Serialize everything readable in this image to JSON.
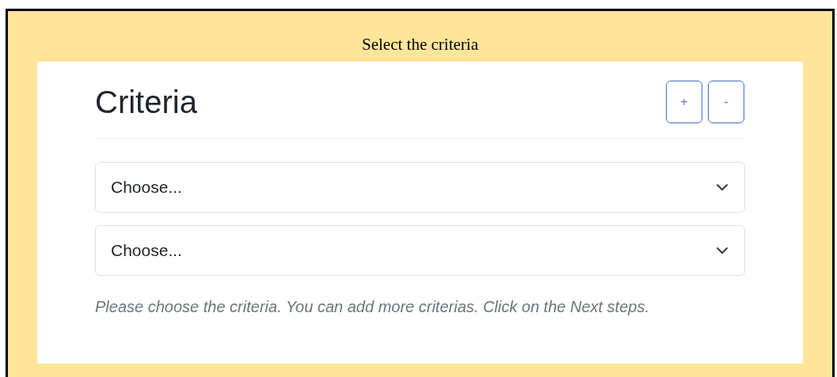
{
  "caption": "Select the criteria",
  "panel": {
    "title": "Criteria",
    "buttons": [
      {
        "label": "+"
      },
      {
        "label": "-"
      }
    ],
    "selects": [
      {
        "value": "Choose..."
      },
      {
        "value": "Choose..."
      }
    ],
    "help_text": "Please choose the criteria. You can add more criterias. Click on the Next steps."
  }
}
